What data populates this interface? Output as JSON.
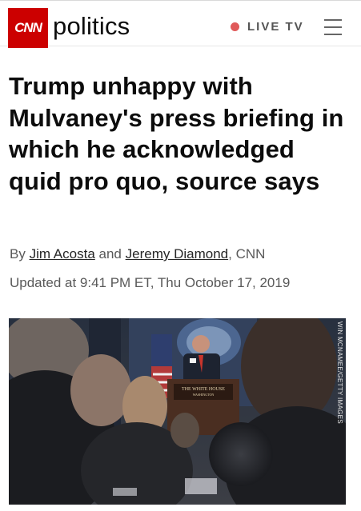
{
  "header": {
    "logo_text": "CNN",
    "section": "politics",
    "live_label": "LIVE TV",
    "accent_color": "#cc0000",
    "live_dot_color": "#e05a5a"
  },
  "article": {
    "headline": "Trump unhappy with Mulvaney's press briefing in which he acknowledged quid pro quo, source says",
    "byline_prefix": "By",
    "author1": "Jim Acosta",
    "and": "and",
    "author2": "Jeremy Diamond",
    "outlet": ", CNN",
    "updated": "Updated at 9:41 PM ET, Thu October 17, 2019"
  },
  "photo": {
    "podium_text_line1": "THE WHITE HOUSE",
    "podium_text_line2": "WASHINGTON",
    "credit": "WIN MCNAMEE/GETTY IMAGES"
  }
}
